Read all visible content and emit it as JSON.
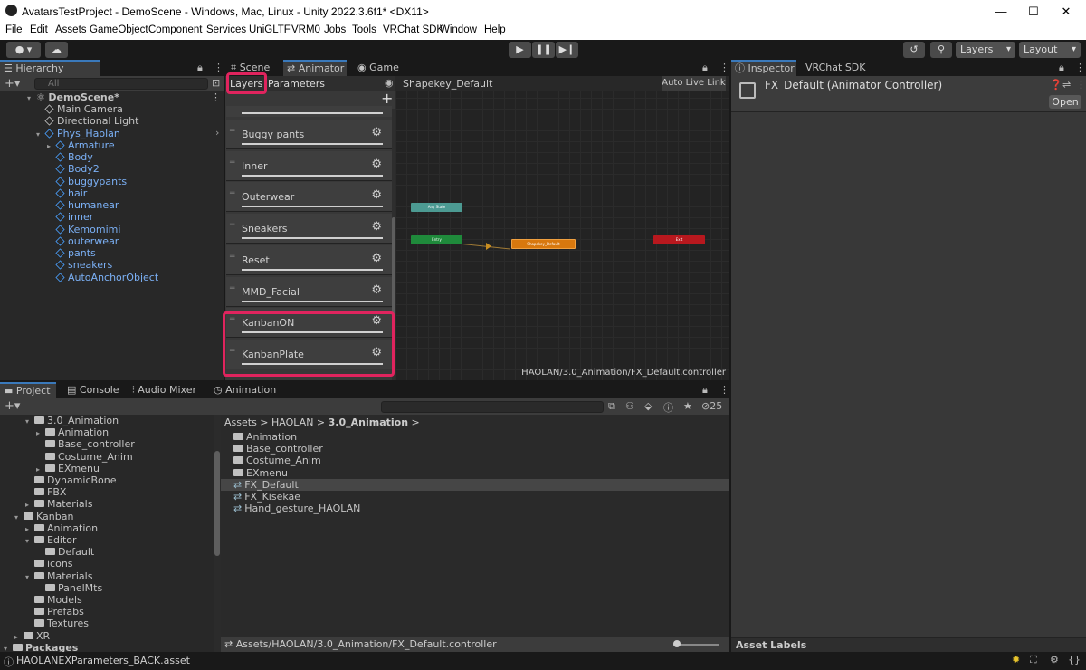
{
  "window": {
    "title": "AvatarsTestProject - DemoScene - Windows, Mac, Linux - Unity 2022.3.6f1* <DX11>"
  },
  "menu": [
    "File",
    "Edit",
    "Assets",
    "GameObject",
    "Component",
    "Services",
    "UniGLTF",
    "VRM0",
    "Jobs",
    "Tools",
    "VRChat SDK",
    "Window",
    "Help"
  ],
  "toolbar": {
    "layers_label": "Layers",
    "layout_label": "Layout"
  },
  "hierarchy": {
    "tab": "Hierarchy",
    "search_placeholder": "All",
    "scene": "DemoScene*",
    "items": [
      {
        "label": "Main Camera",
        "blue": false,
        "depth": 1
      },
      {
        "label": "Directional Light",
        "blue": false,
        "depth": 1
      },
      {
        "label": "Phys_Haolan",
        "blue": true,
        "depth": 1
      },
      {
        "label": "Armature",
        "blue": true,
        "depth": 2
      },
      {
        "label": "Body",
        "blue": true,
        "depth": 2
      },
      {
        "label": "Body2",
        "blue": true,
        "depth": 2
      },
      {
        "label": "buggypants",
        "blue": true,
        "depth": 2
      },
      {
        "label": "hair",
        "blue": true,
        "depth": 2
      },
      {
        "label": "humanear",
        "blue": true,
        "depth": 2
      },
      {
        "label": "inner",
        "blue": true,
        "depth": 2
      },
      {
        "label": "Kemomimi",
        "blue": true,
        "depth": 2
      },
      {
        "label": "outerwear",
        "blue": true,
        "depth": 2
      },
      {
        "label": "pants",
        "blue": true,
        "depth": 2
      },
      {
        "label": "sneakers",
        "blue": true,
        "depth": 2
      },
      {
        "label": "AutoAnchorObject",
        "blue": true,
        "depth": 2
      }
    ]
  },
  "animator": {
    "tabs": [
      "Scene",
      "Animator",
      "Game"
    ],
    "subtabs": {
      "layers": "Layers",
      "parameters": "Parameters"
    },
    "breadcrumb": "Shapekey_Default",
    "auto_live_link": "Auto Live Link",
    "layers": [
      "Buggy pants",
      "Inner",
      "Outerwear",
      "Sneakers",
      "Reset",
      "MMD_Facial",
      "KanbanON",
      "KanbanPlate"
    ],
    "nodes": {
      "any_state": "Any State",
      "entry": "Entry",
      "default": "Shapekey_Default",
      "exit": "Exit"
    },
    "footer_path": "HAOLAN/3.0_Animation/FX_Default.controller"
  },
  "project": {
    "tabs": [
      "Project",
      "Console",
      "Audio Mixer",
      "Animation"
    ],
    "count": "25",
    "tree": [
      {
        "label": "3.0_Animation",
        "depth": 2,
        "open": true
      },
      {
        "label": "Animation",
        "depth": 3,
        "arrow": true
      },
      {
        "label": "Base_controller",
        "depth": 3
      },
      {
        "label": "Costume_Anim",
        "depth": 3
      },
      {
        "label": "EXmenu",
        "depth": 3,
        "arrow": true
      },
      {
        "label": "DynamicBone",
        "depth": 2
      },
      {
        "label": "FBX",
        "depth": 2
      },
      {
        "label": "Materials",
        "depth": 2,
        "arrow": true
      },
      {
        "label": "Kanban",
        "depth": 1,
        "open": true
      },
      {
        "label": "Animation",
        "depth": 2,
        "arrow": true
      },
      {
        "label": "Editor",
        "depth": 2,
        "open": true
      },
      {
        "label": "Default",
        "depth": 3
      },
      {
        "label": "icons",
        "depth": 2
      },
      {
        "label": "Materials",
        "depth": 2,
        "open": true
      },
      {
        "label": "PanelMts",
        "depth": 3
      },
      {
        "label": "Models",
        "depth": 2
      },
      {
        "label": "Prefabs",
        "depth": 2
      },
      {
        "label": "Textures",
        "depth": 2
      },
      {
        "label": "XR",
        "depth": 1,
        "arrow": true
      },
      {
        "label": "Packages",
        "depth": 0,
        "open": true,
        "bold": true
      }
    ],
    "breadcrumb": [
      "Assets",
      "HAOLAN",
      "3.0_Animation"
    ],
    "files": [
      {
        "label": "Animation",
        "type": "folder"
      },
      {
        "label": "Base_controller",
        "type": "folder"
      },
      {
        "label": "Costume_Anim",
        "type": "folder"
      },
      {
        "label": "EXmenu",
        "type": "folder"
      },
      {
        "label": "FX_Default",
        "type": "controller",
        "selected": true
      },
      {
        "label": "FX_Kisekae",
        "type": "controller"
      },
      {
        "label": "Hand_gesture_HAOLAN",
        "type": "controller"
      }
    ],
    "selected_path": "Assets/HAOLAN/3.0_Animation/FX_Default.controller"
  },
  "inspector": {
    "tabs": [
      "Inspector",
      "VRChat SDK"
    ],
    "object_title": "FX_Default (Animator Controller)",
    "open_label": "Open",
    "asset_labels": "Asset Labels"
  },
  "status": {
    "message": "HAOLANEXParameters_BACK.asset"
  },
  "colors": {
    "accent": "#3a79bb",
    "highlight": "#e0245e",
    "any_state": "#4c9a92",
    "entry": "#1f8a3b",
    "default_state": "#d8780e",
    "exit": "#b8181e"
  }
}
